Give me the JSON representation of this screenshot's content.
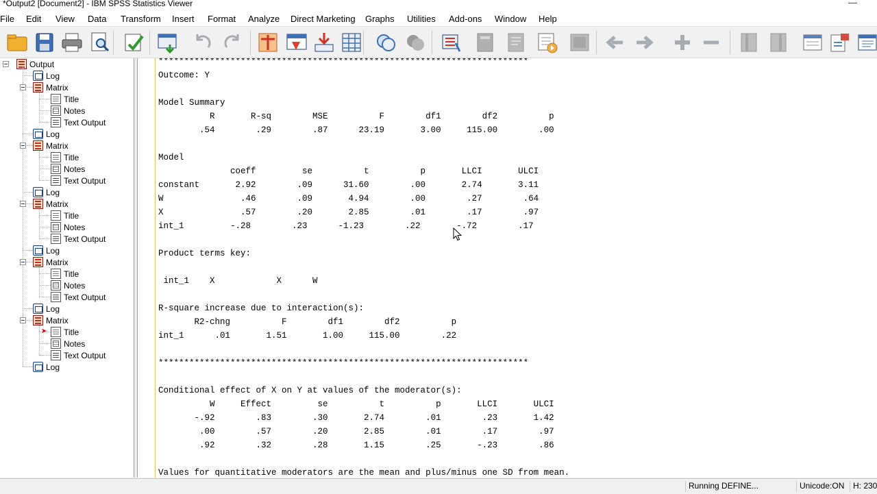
{
  "window": {
    "title": "*Output2 [Document2] - IBM SPSS Statistics Viewer",
    "minimize_glyph": "—"
  },
  "menu": [
    "File",
    "Edit",
    "View",
    "Data",
    "Transform",
    "Insert",
    "Format",
    "Analyze",
    "Direct Marketing",
    "Graphs",
    "Utilities",
    "Add-ons",
    "Window",
    "Help"
  ],
  "toolbar": {
    "icons": [
      "open-folder-icon",
      "save-icon",
      "print-icon",
      "print-preview-icon",
      "export-icon",
      "recall-dialog-icon",
      "undo-icon",
      "redo-icon",
      "goto-data-icon",
      "goto-case-icon",
      "goto-variable-icon",
      "variables-icon",
      "use-variable-sets-icon",
      "show-all-variables-icon",
      "spelling-icon",
      "split-file-icon",
      "weight-cases-icon",
      "select-cases-icon",
      "value-labels-icon",
      "use-sets-icon",
      "run-script-icon",
      "designate-window-icon",
      "previous-icon",
      "next-icon",
      "expand-icon",
      "collapse-icon",
      "show-icon",
      "hide-icon",
      "insert-heading-icon",
      "insert-title-icon",
      "insert-text-icon"
    ]
  },
  "tree": {
    "root": "Output",
    "items": [
      {
        "level": 1,
        "type": "log",
        "label": "Log"
      },
      {
        "level": 1,
        "type": "matrix",
        "label": "Matrix",
        "expanded": true
      },
      {
        "level": 2,
        "type": "title",
        "label": "Title"
      },
      {
        "level": 2,
        "type": "notes",
        "label": "Notes"
      },
      {
        "level": 2,
        "type": "text",
        "label": "Text Output"
      },
      {
        "level": 1,
        "type": "log",
        "label": "Log"
      },
      {
        "level": 1,
        "type": "matrix",
        "label": "Matrix",
        "expanded": true
      },
      {
        "level": 2,
        "type": "title",
        "label": "Title"
      },
      {
        "level": 2,
        "type": "notes",
        "label": "Notes"
      },
      {
        "level": 2,
        "type": "text",
        "label": "Text Output"
      },
      {
        "level": 1,
        "type": "log",
        "label": "Log"
      },
      {
        "level": 1,
        "type": "matrix",
        "label": "Matrix",
        "expanded": true
      },
      {
        "level": 2,
        "type": "title",
        "label": "Title"
      },
      {
        "level": 2,
        "type": "notes",
        "label": "Notes"
      },
      {
        "level": 2,
        "type": "text",
        "label": "Text Output"
      },
      {
        "level": 1,
        "type": "log",
        "label": "Log"
      },
      {
        "level": 1,
        "type": "matrix",
        "label": "Matrix",
        "expanded": true
      },
      {
        "level": 2,
        "type": "title",
        "label": "Title"
      },
      {
        "level": 2,
        "type": "notes",
        "label": "Notes"
      },
      {
        "level": 2,
        "type": "text",
        "label": "Text Output"
      },
      {
        "level": 1,
        "type": "log",
        "label": "Log"
      },
      {
        "level": 1,
        "type": "matrix",
        "label": "Matrix",
        "expanded": true
      },
      {
        "level": 2,
        "type": "title",
        "label": "Title",
        "current": true
      },
      {
        "level": 2,
        "type": "notes",
        "label": "Notes"
      },
      {
        "level": 2,
        "type": "text",
        "label": "Text Output"
      },
      {
        "level": 1,
        "type": "log",
        "label": "Log"
      }
    ]
  },
  "output_lines": [
    "************************************************************************",
    "Outcome: Y",
    "",
    "Model Summary",
    "          R       R-sq        MSE          F        df1        df2          p",
    "        .54        .29        .87      23.19       3.00     115.00        .00",
    "",
    "Model",
    "              coeff         se          t          p       LLCI       ULCI",
    "constant       2.92        .09      31.60        .00       2.74       3.11",
    "W               .46        .09       4.94        .00        .27        .64",
    "X               .57        .20       2.85        .01        .17        .97",
    "int_1         -.28        .23      -1.23        .22       -.72        .17",
    "",
    "Product terms key:",
    "",
    " int_1    X            X      W",
    "",
    "R-square increase due to interaction(s):",
    "       R2-chng          F        df1        df2          p",
    "int_1      .01       1.51       1.00     115.00        .22",
    "",
    "************************************************************************",
    "",
    "Conditional effect of X on Y at values of the moderator(s):",
    "          W     Effect         se          t          p       LLCI       ULCI",
    "       -.92        .83        .30       2.74        .01        .23       1.42",
    "        .00        .57        .20       2.85        .01        .17        .97",
    "        .92        .32        .28       1.15        .25       -.23        .86",
    "",
    "Values for quantitative moderators are the mean and plus/minus one SD from mean."
  ],
  "status": {
    "processor": "Running DEFINE...",
    "unicode": "Unicode:ON",
    "height": "H: 230"
  },
  "colors": {
    "accent_blue": "#1b3f8b",
    "tree_matrix_red": "#c82a1f",
    "current_marker": "#d20000",
    "content_border_yellow": "#f0c050"
  }
}
